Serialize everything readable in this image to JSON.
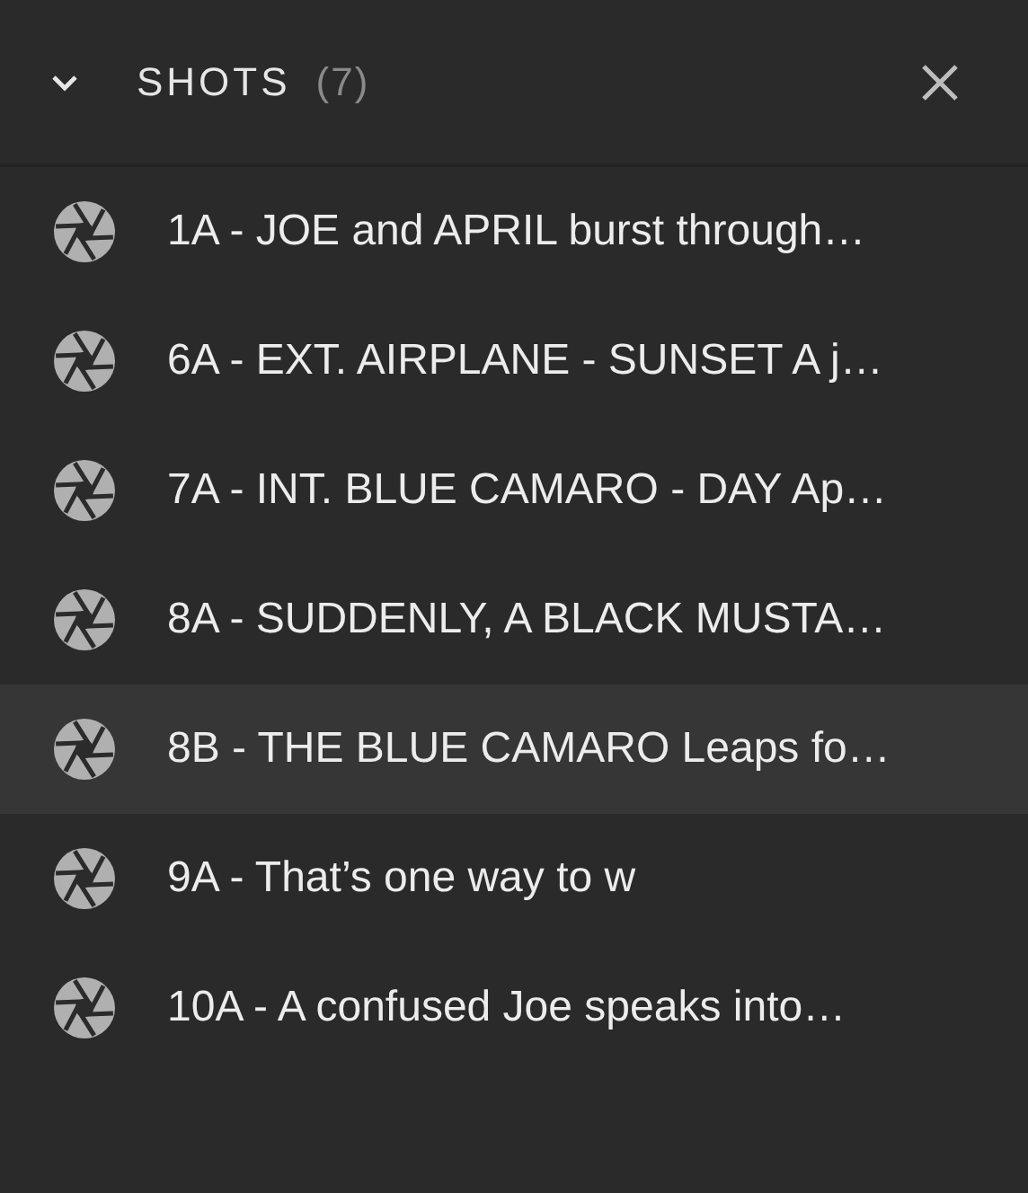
{
  "panel": {
    "title": "SHOTS",
    "count": "(7)",
    "expanded": true
  },
  "shots": [
    {
      "label": "1A - JOE and APRIL burst through…",
      "selected": false
    },
    {
      "label": "6A - EXT. AIRPLANE - SUNSET A j…",
      "selected": false
    },
    {
      "label": "7A - INT. BLUE CAMARO - DAY Ap…",
      "selected": false
    },
    {
      "label": "8A - SUDDENLY, A BLACK MUSTA…",
      "selected": false
    },
    {
      "label": "8B - THE BLUE CAMARO Leaps fo…",
      "selected": true
    },
    {
      "label": "9A - That’s one way to w",
      "selected": false
    },
    {
      "label": "10A - A confused Joe speaks into…",
      "selected": false
    }
  ]
}
